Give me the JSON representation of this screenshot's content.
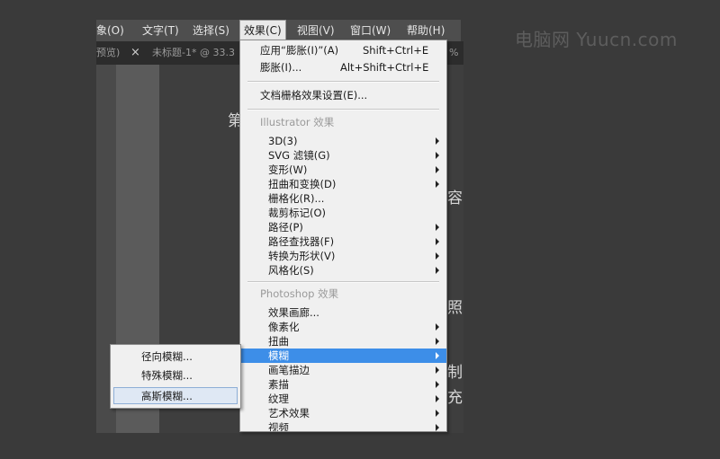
{
  "menubar": {
    "items": [
      {
        "label": "象(O)"
      },
      {
        "label": "文字(T)"
      },
      {
        "label": "选择(S)"
      },
      {
        "label": "效果(C)",
        "active": true
      },
      {
        "label": "视图(V)"
      },
      {
        "label": "窗口(W)"
      },
      {
        "label": "帮助(H)"
      }
    ]
  },
  "tabs": {
    "left_fragment": "预览)",
    "close_symbol": "×",
    "doc_title": "未标题-1* @ 33.3",
    "right_fragment": "%"
  },
  "watermark": "电脑网 Yuucn.com",
  "canvas_fragments": [
    "第",
    "容",
    "照",
    "制",
    "充"
  ],
  "effect_menu": {
    "top_items": [
      {
        "label": "应用“膨胀(I)”(A)",
        "shortcut": "Shift+Ctrl+E"
      },
      {
        "label": "膨胀(I)...",
        "shortcut": "Alt+Shift+Ctrl+E"
      }
    ],
    "doc_raster_settings": "文档栅格效果设置(E)...",
    "illustrator_header": "Illustrator 效果",
    "illustrator_items": [
      {
        "label": "3D(3)",
        "has_submenu": true
      },
      {
        "label": "SVG 滤镜(G)",
        "has_submenu": true
      },
      {
        "label": "变形(W)",
        "has_submenu": true
      },
      {
        "label": "扭曲和变换(D)",
        "has_submenu": true
      },
      {
        "label": "栅格化(R)...",
        "has_submenu": false
      },
      {
        "label": "裁剪标记(O)",
        "has_submenu": false
      },
      {
        "label": "路径(P)",
        "has_submenu": true
      },
      {
        "label": "路径查找器(F)",
        "has_submenu": true
      },
      {
        "label": "转换为形状(V)",
        "has_submenu": true
      },
      {
        "label": "风格化(S)",
        "has_submenu": true
      }
    ],
    "photoshop_header": "Photoshop 效果",
    "photoshop_items": [
      {
        "label": "效果画廊...",
        "has_submenu": false
      },
      {
        "label": "像素化",
        "has_submenu": true
      },
      {
        "label": "扭曲",
        "has_submenu": true
      },
      {
        "label": "模糊",
        "has_submenu": true,
        "highlighted": true
      },
      {
        "label": "画笔描边",
        "has_submenu": true
      },
      {
        "label": "素描",
        "has_submenu": true
      },
      {
        "label": "纹理",
        "has_submenu": true
      },
      {
        "label": "艺术效果",
        "has_submenu": true
      },
      {
        "label": "视频",
        "has_submenu": true
      }
    ]
  },
  "blur_submenu": {
    "items": [
      {
        "label": "径向模糊..."
      },
      {
        "label": "特殊模糊..."
      },
      {
        "label": "高斯模糊...",
        "selected": true
      }
    ]
  },
  "colors": {
    "highlight": "#3d8ee8",
    "menu_bg": "#f0f0f0",
    "menubar_bg": "#4e4e4e"
  }
}
